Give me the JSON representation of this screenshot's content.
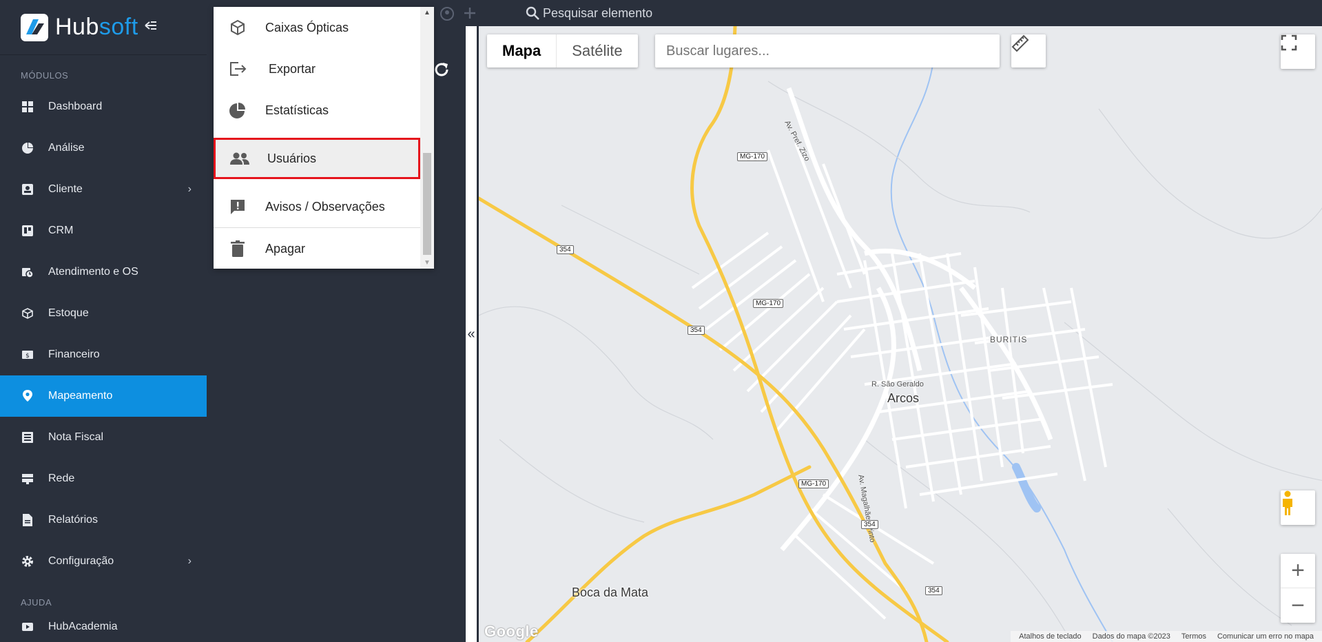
{
  "brand": {
    "name_part1": "Hub",
    "name_part2": "soft"
  },
  "sidebar": {
    "section_modules": "MÓDULOS",
    "items": [
      {
        "label": "Dashboard",
        "icon": "dashboard-icon"
      },
      {
        "label": "Análise",
        "icon": "pie-chart-icon"
      },
      {
        "label": "Cliente",
        "icon": "contact-card-icon",
        "chevron": "›"
      },
      {
        "label": "CRM",
        "icon": "trello-board-icon"
      },
      {
        "label": "Atendimento e OS",
        "icon": "calendar-clock-icon"
      },
      {
        "label": "Estoque",
        "icon": "cube-icon"
      },
      {
        "label": "Financeiro",
        "icon": "money-bill-icon"
      },
      {
        "label": "Mapeamento",
        "icon": "map-pin-icon",
        "active": true
      },
      {
        "label": "Nota Fiscal",
        "icon": "document-list-icon"
      },
      {
        "label": "Rede",
        "icon": "server-icon"
      },
      {
        "label": "Relatórios",
        "icon": "report-file-icon"
      },
      {
        "label": "Configuração",
        "icon": "gear-icon",
        "chevron": "›"
      }
    ],
    "section_help": "AJUDA",
    "help_items": [
      {
        "label": "HubAcademia",
        "icon": "video-icon"
      }
    ]
  },
  "topbar": {
    "search_placeholder": "Pesquisar elemento"
  },
  "menu": {
    "items": [
      {
        "label": "Caixas Ópticas",
        "icon": "cube-outline-icon"
      },
      {
        "label": " Exportar",
        "icon": "export-icon"
      },
      {
        "label": "Estatísticas",
        "icon": "pie-chart-icon"
      },
      {
        "label": "Usuários",
        "icon": "users-icon",
        "highlighted": true
      },
      {
        "label": "Avisos / Observações",
        "icon": "alert-message-icon"
      },
      {
        "label": "Apagar",
        "icon": "trash-icon"
      }
    ]
  },
  "collapse_toggle": "«",
  "map": {
    "type_map": "Mapa",
    "type_satellite": "Satélite",
    "search_placeholder": "Buscar lugares...",
    "zoom_in": "+",
    "zoom_out": "−",
    "google": "Google",
    "attribution": {
      "shortcuts": "Atalhos de teclado",
      "data": "Dados do mapa ©2023",
      "terms": "Termos",
      "report": "Comunicar um erro no mapa"
    },
    "labels": {
      "city": "Arcos",
      "town": "Boca da Mata",
      "district": "BURITIS",
      "street_1": "R. São Geraldo",
      "street_2": "Av. Magalhães Pinto",
      "street_3": "Av. Pref. Zizo"
    },
    "shields": [
      "MG-170",
      "MG-170",
      "MG-170",
      "354",
      "354",
      "354",
      "354"
    ]
  },
  "colors": {
    "sidebar_bg": "#2a303c",
    "accent": "#0d8fe0",
    "highlight_border": "#e5141c",
    "road_major": "#f7c945"
  }
}
